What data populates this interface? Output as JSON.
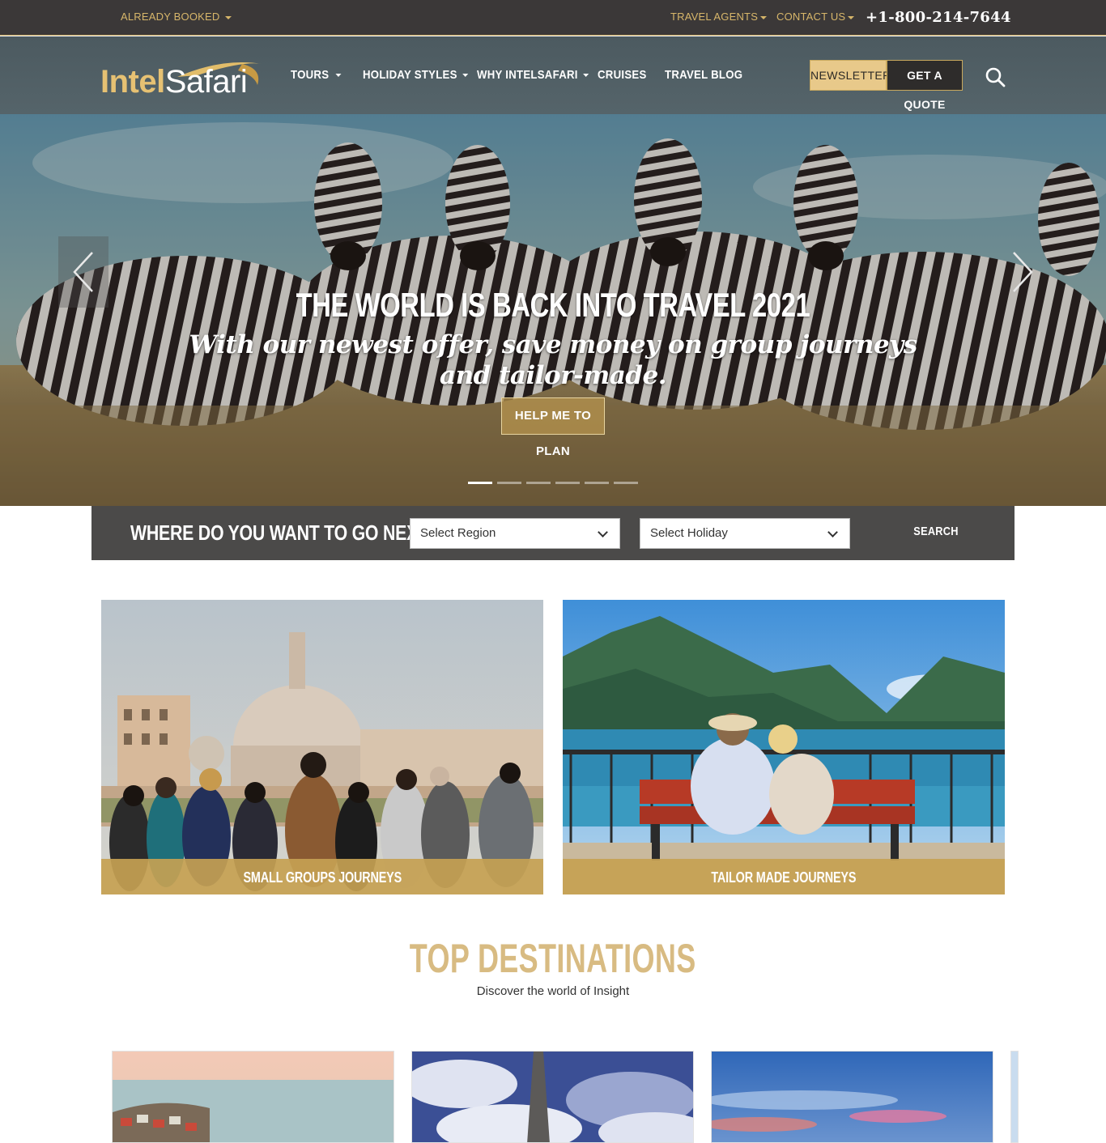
{
  "topbar": {
    "already_booked": "ALREADY BOOKED",
    "travel_agents": "TRAVEL AGENTS",
    "contact_us": "CONTACT US",
    "phone": "+1-800-214-7644"
  },
  "header": {
    "logo_part1": "Intel",
    "logo_part2": "Safari",
    "nav": {
      "tours": "TOURS",
      "holiday_styles": "HOLIDAY STYLES",
      "why": "WHY INTELSAFARI",
      "cruises": "CRUISES",
      "blog": "TRAVEL BLOG"
    },
    "newsletter": "NEWSLETTER",
    "quote": "GET A QUOTE"
  },
  "hero": {
    "title": "THE WORLD IS BACK INTO TRAVEL 2021",
    "subtitle": "With our newest offer, save money on group journeys and tailor-made.",
    "cta": "HELP ME TO PLAN",
    "slide_count": 6,
    "active_slide": 1
  },
  "finder": {
    "label": "WHERE DO YOU WANT TO GO NEXT.?",
    "region": "Select Region",
    "holiday": "Select Holiday",
    "search": "SEARCH"
  },
  "journeys": {
    "small_groups": "SMALL GROUPS JOURNEYS",
    "tailor_made": "TAILOR MADE JOURNEYS"
  },
  "destinations": {
    "title": "TOP DESTINATIONS",
    "subtitle": "Discover the world of Insight"
  },
  "colors": {
    "gold": "#c9a95e",
    "dark": "#3b3838",
    "header": "#51606a"
  }
}
